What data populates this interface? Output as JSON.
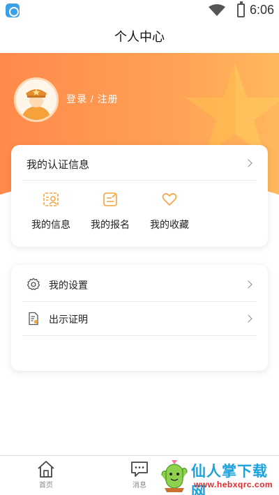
{
  "status_bar": {
    "time": "6:06"
  },
  "header": {
    "title": "个人中心"
  },
  "profile": {
    "login_label": "登录 / 注册"
  },
  "auth_card": {
    "title": "我的认证信息",
    "quick_actions": [
      {
        "label": "我的信息",
        "icon": "id-card-icon"
      },
      {
        "label": "我的报名",
        "icon": "edit-form-icon"
      },
      {
        "label": "我的收藏",
        "icon": "heart-icon"
      }
    ]
  },
  "settings_card": {
    "items": [
      {
        "label": "我的设置",
        "icon": "gear-icon"
      },
      {
        "label": "出示证明",
        "icon": "certificate-icon"
      }
    ]
  },
  "tab_bar": {
    "tabs": [
      {
        "label": "首页",
        "icon": "home-icon"
      },
      {
        "label": "消息",
        "icon": "message-icon"
      }
    ]
  },
  "watermark": {
    "title": "仙人掌下载网",
    "url": "www.hebxqrc.com"
  },
  "colors": {
    "accent": "#ff9a4e",
    "icon_orange": "#f5a23c"
  }
}
